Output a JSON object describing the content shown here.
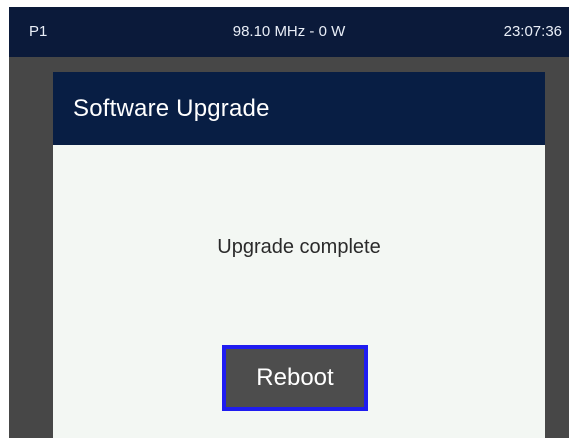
{
  "status_bar": {
    "preset": "P1",
    "frequency_power": "98.10 MHz - 0 W",
    "time": "23:07:36"
  },
  "dialog": {
    "title": "Software Upgrade",
    "message": "Upgrade complete",
    "reboot_label": "Reboot"
  },
  "colors": {
    "status_bar_bg": "#0b1a3a",
    "dialog_header_bg": "#081e44",
    "screen_bg": "#474747",
    "dialog_body_bg": "#f3f7f3",
    "button_bg": "#4d4d4d",
    "button_focus_border": "#1f1cf0"
  }
}
